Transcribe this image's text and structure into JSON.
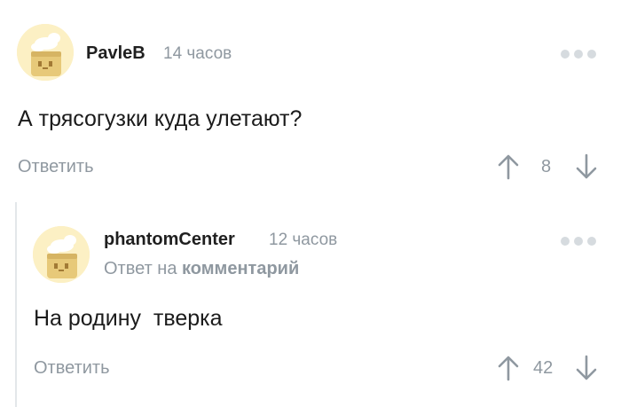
{
  "comments": [
    {
      "username": "PavleB",
      "time": "14 часов",
      "text": "А трясогузки куда улетают?",
      "reply_label": "Ответить",
      "score": "8"
    },
    {
      "username": "phantomCenter",
      "time": "12 часов",
      "reply_to_prefix": "Ответ на",
      "reply_to_link": "комментарий",
      "text": "На родину  тверка",
      "reply_label": "Ответить",
      "score": "42"
    }
  ],
  "icons": {
    "avatar": "default-avatar-icon",
    "more": "more-dots-icon",
    "upvote": "arrow-up-icon",
    "downvote": "arrow-down-icon"
  },
  "colors": {
    "muted": "#8f98a0",
    "avatar_bg": "#fcf0c4",
    "text": "#1b1b1b"
  }
}
